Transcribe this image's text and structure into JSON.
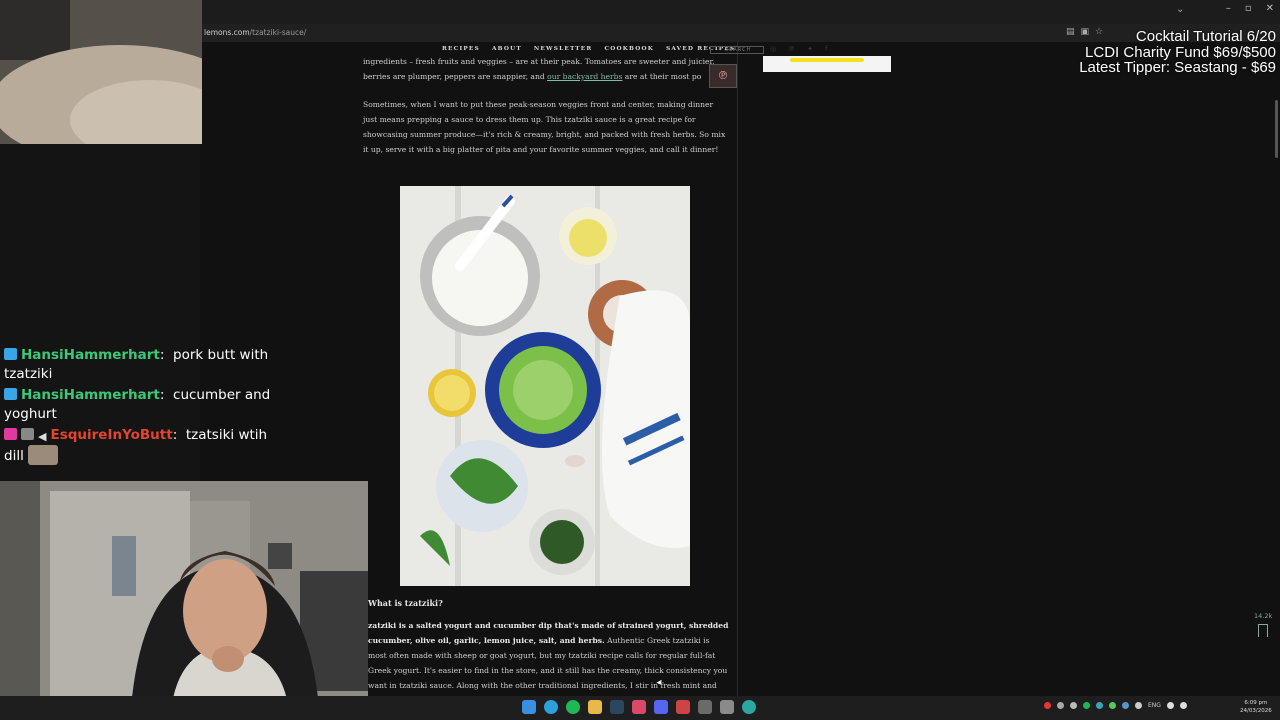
{
  "browser": {
    "url_domain": "lemons.com",
    "url_path": "/tzatziki-sauce/",
    "tab_chevron": "⌄",
    "window_controls": [
      "–",
      "▫",
      "✕"
    ]
  },
  "site_nav": {
    "items": [
      "RECIPES",
      "ABOUT",
      "NEWSLETTER",
      "COOKBOOK",
      "SAVED RECIPES"
    ],
    "search_placeholder": "SEARCH"
  },
  "article": {
    "p1_line1": "ingredients – fresh fruits and veggies – are at their peak. Tomatoes are sweeter and juicier,",
    "p1_line2_pre": "berries are plumper, peppers are snappier, and ",
    "p1_link": "our backyard herbs",
    "p1_line2_post": " are at their most po",
    "p2": "Sometimes, when I want to put these peak-season veggies front and center, making dinner just means prepping a sauce to dress them up. This tzatziki sauce is a great recipe for showcasing summer produce—it's rich & creamy, bright, and packed with fresh herbs. So mix it up, serve it with a big platter of pita and your favorite summer veggies, and call it dinner!",
    "heading_what": "What is tzatziki?",
    "p3_bold": "zatziki is a salted yogurt and cucumber dip that's made of strained yogurt, shredded cucumber, olive oil, garlic, lemon juice, salt, and herbs.",
    "p3_rest": " Authentic Greek tzatziki is most often made with sheep or goat yogurt, but my tzatziki recipe calls for regular full-fat Greek yogurt. It's easier to find in the store, and it still has the creamy, thick consistency you want in tzatziki sauce. Along with the other traditional ingredients, I stir in fresh mint and dill for",
    "save_count": "14.2k"
  },
  "overlay": {
    "line1": "Cocktail Tutorial 6/20",
    "line2": "LCDI Charity Fund $69/$500",
    "line3": "Latest Tipper: Seastang  - $69"
  },
  "chat": {
    "messages": [
      {
        "user": "HansiHammerhart",
        "sep": ":",
        "text": "pork butt with tzatziki"
      },
      {
        "user": "HansiHammerhart",
        "sep": ":",
        "text": "cucumber and yoghurt"
      },
      {
        "user": "EsquireInYoButt",
        "sep": ":",
        "text": "tzatsiki wtih dill"
      }
    ]
  },
  "taskbar": {
    "lang": "ENG",
    "time": "6:09 pm",
    "date": "24/03/2026"
  },
  "colors": {
    "link": "#7fbcaa",
    "chat_green": "#3ac97a",
    "chat_red": "#e2442d",
    "ad_yellow": "#f2e21a"
  }
}
